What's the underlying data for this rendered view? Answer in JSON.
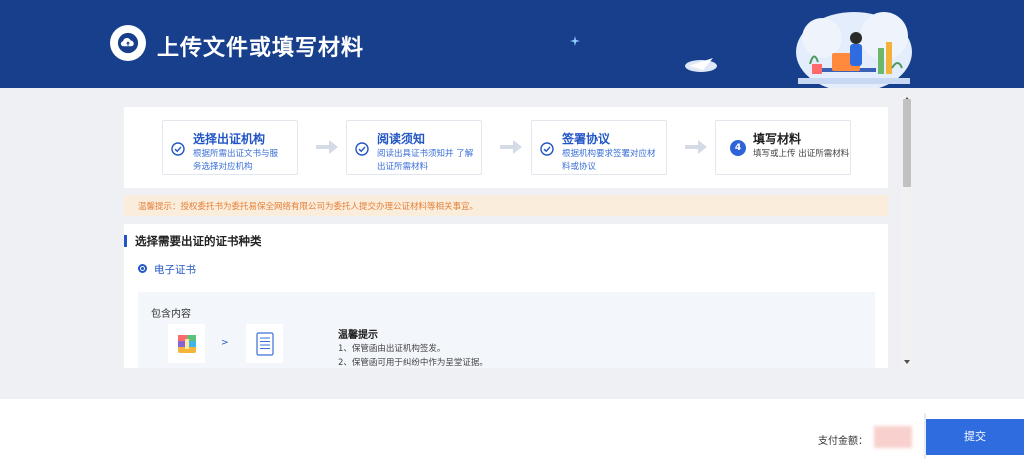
{
  "header": {
    "title": "上传文件或填写材料",
    "icon": "cloud-upload-icon"
  },
  "steps": [
    {
      "title": "选择出证机构",
      "desc": "根据所需出证文书与服务选择对应机构",
      "state": "done"
    },
    {
      "title": "阅读须知",
      "desc": "阅读出具证书须知并 了解出证所需材料",
      "state": "done"
    },
    {
      "title": "签署协议",
      "desc": "根据机构要求签署对应材料或协议",
      "state": "done"
    },
    {
      "number": "4",
      "title": "填写材料",
      "desc": "填写或上传 出证所需材料",
      "state": "active"
    }
  ],
  "notice": {
    "text": "温馨提示：授权委托书为委托易保全网络有限公司为委托人提交办理公证材料等相关事宜。"
  },
  "section": {
    "title": "选择需要出证的证书种类",
    "option_label": "电子证书",
    "includes_label": "包含内容",
    "arrow": ">",
    "tips_title": "温馨提示",
    "tips": [
      "1、保管函由出证机构签发。",
      "2、保管函可用于纠纷中作为呈堂证据。"
    ]
  },
  "footer": {
    "pay_label": "支付金额：",
    "submit_label": "提交"
  },
  "colors": {
    "header_bg": "#173f8c",
    "accent": "#2356c5",
    "button": "#2f6ce0",
    "notice_bg": "#fbeddb",
    "notice_text": "#e5803a"
  }
}
